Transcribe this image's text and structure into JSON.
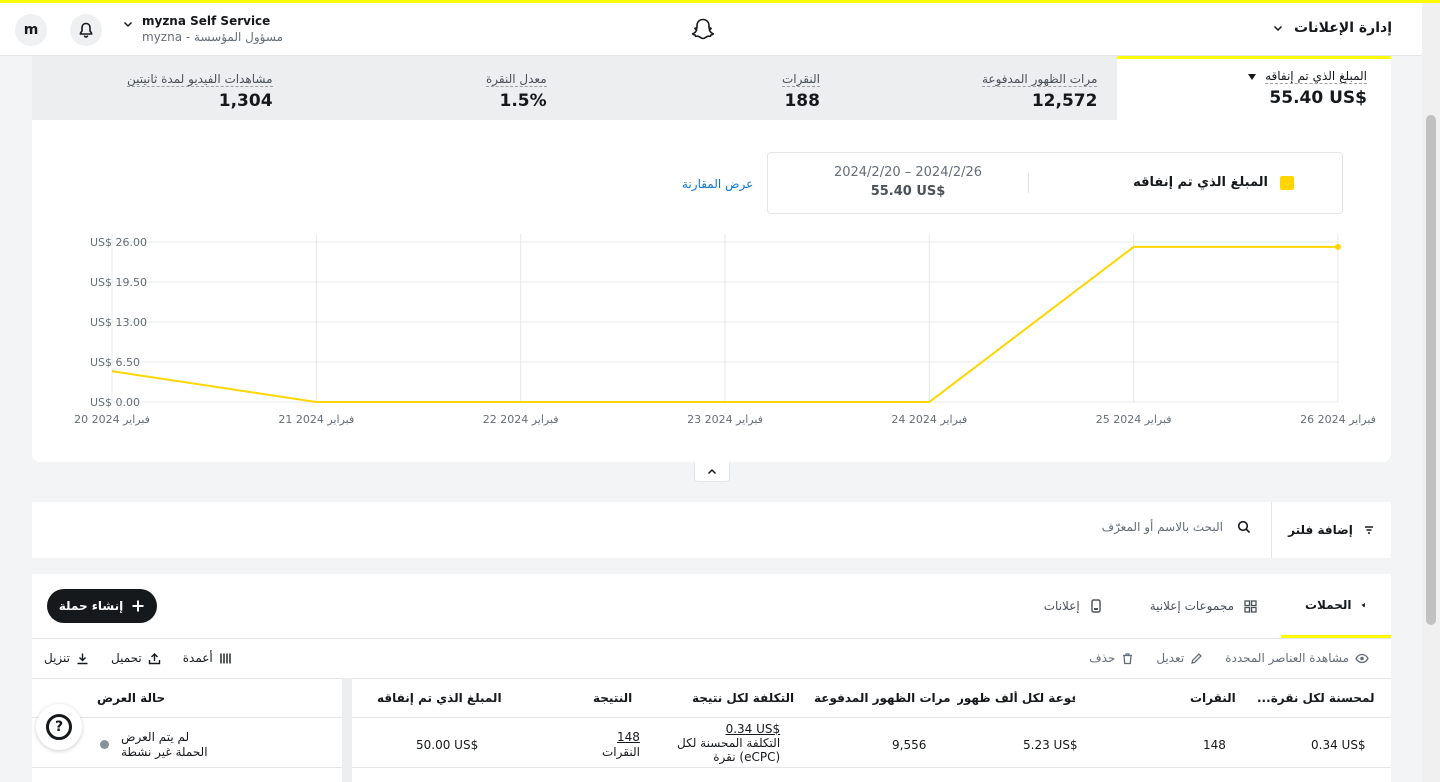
{
  "header": {
    "avatar_letter": "m",
    "org_name": "myzna Self Service",
    "org_sub": "myzna - مسؤول المؤسسة",
    "menu_title": "إدارة الإعلانات"
  },
  "stats": {
    "selected": {
      "label": "المبلغ الذي تم إنفاقه",
      "value": "55.40 US$"
    },
    "items": [
      {
        "label": "مرات الظهور المدفوعة",
        "value": "12,572"
      },
      {
        "label": "النقرات",
        "value": "188"
      },
      {
        "label": "معدل النقرة",
        "value": "1.5%"
      },
      {
        "label": "مشاهدات الفيديو لمدة ثانيتين",
        "value": "1,304"
      }
    ]
  },
  "legend": {
    "series_name": "المبلغ الذي تم إنفاقه",
    "range": "2024/2/20 – 2024/2/26",
    "amount": "55.40 US$",
    "compare_link": "عرض المقارنة"
  },
  "chart_data": {
    "type": "line",
    "series": [
      {
        "name": "المبلغ الذي تم إنفاقه",
        "color": "#ffd600",
        "values": [
          5.0,
          0.0,
          0.0,
          0.0,
          0.0,
          25.2,
          25.2
        ]
      }
    ],
    "categories": [
      "20 فبراير 2024",
      "21 فبراير 2024",
      "22 فبراير 2024",
      "23 فبراير 2024",
      "24 فبراير 2024",
      "25 فبراير 2024",
      "26 فبراير 2024"
    ],
    "yticks": [
      "US$ 0.00",
      "US$ 6.50",
      "US$ 13.00",
      "US$ 19.50",
      "US$ 26.00"
    ],
    "ytick_values": [
      0,
      6.5,
      13,
      19.5,
      26
    ],
    "ylim": [
      0,
      26
    ],
    "grid": true
  },
  "filter": {
    "add_filter": "إضافة فلتر",
    "search_placeholder": "البحث بالاسم أو المعرّف"
  },
  "table": {
    "create_button": "إنشاء حملة",
    "tabs": [
      {
        "label": "الحملات",
        "icon": "megaphone-icon"
      },
      {
        "label": "مجموعات إعلانية",
        "icon": "grid-icon"
      },
      {
        "label": "إعلانات",
        "icon": "phone-icon"
      }
    ],
    "toolbar_left": {
      "download": "تنزيل",
      "upload": "تحميل",
      "columns": "أعمدة"
    },
    "toolbar_right": {
      "view_selected": "مشاهدة العناصر المحددة",
      "edit": "تعديل",
      "delete": "حذف"
    },
    "headers": {
      "status": "حالة العرض",
      "spend": "المبلغ الذي تم إنفاقه",
      "result": "النتيجة",
      "cost_per_result": "التكلفة لكل نتيجة",
      "impressions": "مرات الظهور المدفوعة",
      "cpm": "دفوعة لكل ألف ظهور...",
      "clicks": "النقرات",
      "ecpc": "...لفة المحسنة لكل نقرة"
    },
    "row": {
      "status_line1": "لم يتم العرض",
      "status_line2": "الحملة غير نشطة",
      "spend": "50.00 US$",
      "result_value": "148",
      "result_unit": "النقرات",
      "cost_value": "0.34 US$",
      "cost_line2": "التكلفة المحسنة لكل",
      "cost_line3": "نقرة (eCPC)",
      "impressions": "9,556",
      "cpm": "5.23 US$",
      "clicks": "148",
      "ecpc": "0.34 US$"
    }
  }
}
